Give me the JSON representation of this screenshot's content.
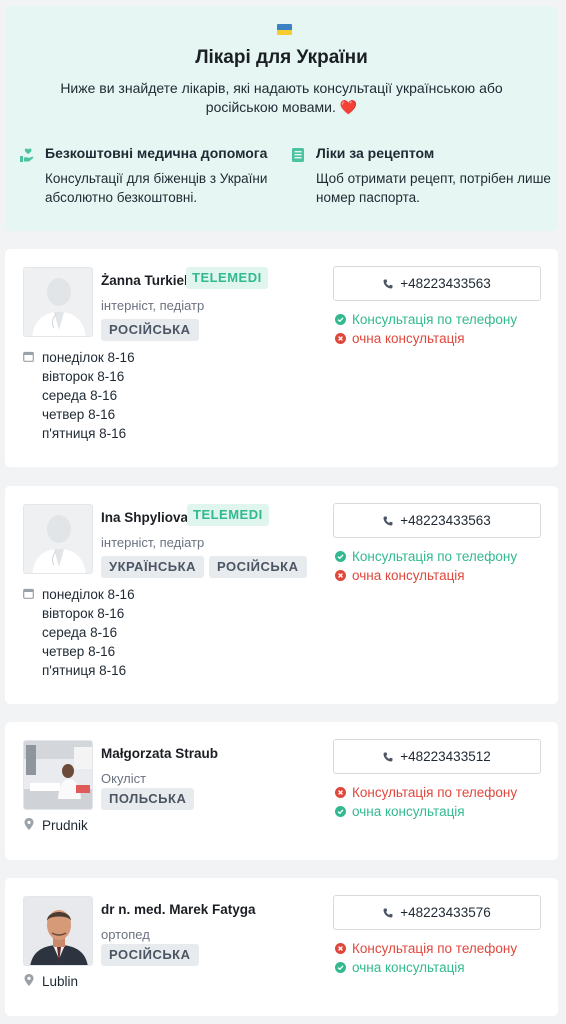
{
  "hero": {
    "title": "Лікарі для України",
    "subtitle": "Ниже ви знайдете лікарів, які надають консультації українською або російською мовами.",
    "heart": "❤️",
    "features": [
      {
        "icon": "hand-heart-icon",
        "title": "Безкоштовні медична допомога",
        "text": "Консультації для біженців з України абсолютно безкоштовні."
      },
      {
        "icon": "document-icon",
        "title": "Ліки за рецептом",
        "text": "Щоб отримати рецепт, потрібен лише номер паспорта."
      }
    ]
  },
  "colors": {
    "accent": "#31b98f",
    "danger": "#e0473c",
    "hero_bg": "#e6f6f2"
  },
  "doctors": [
    {
      "name": "Żanna Turkiel",
      "badge": "TELEMEDI",
      "specialty": "інтерніст, педіатр",
      "languages": [
        "РОСІЙСЬКА"
      ],
      "phone": "+48223433563",
      "schedule": [
        "понеділок 8-16",
        "вівторок 8-16",
        "середа 8-16",
        "четвер 8-16",
        "п'ятниця 8-16"
      ],
      "phone_consultation": {
        "label": "Консультація по телефону",
        "available": true
      },
      "in_person": {
        "label": "очна консультація",
        "available": false
      }
    },
    {
      "name": "Ina Shpyliova",
      "badge": "TELEMEDI",
      "specialty": "інтерніст, педіатр",
      "languages": [
        "УКРАЇНСЬКА",
        "РОСІЙСЬКА"
      ],
      "phone": "+48223433563",
      "schedule": [
        "понеділок 8-16",
        "вівторок 8-16",
        "середа 8-16",
        "четвер 8-16",
        "п'ятниця 8-16"
      ],
      "phone_consultation": {
        "label": "Консультація по телефону",
        "available": true
      },
      "in_person": {
        "label": "очна консультація",
        "available": false
      }
    },
    {
      "name": "Małgorzata Straub",
      "specialty": "Окуліст",
      "languages": [
        "ПОЛЬСЬКА"
      ],
      "phone": "+48223433512",
      "location": "Prudnik",
      "phone_consultation": {
        "label": "Консультація по телефону",
        "available": false
      },
      "in_person": {
        "label": "очна консультація",
        "available": true
      }
    },
    {
      "name": "dr n. med. Marek Fatyga",
      "specialty": "ортопед",
      "languages": [
        "РОСІЙСЬКА"
      ],
      "phone": "+48223433576",
      "location": "Lublin",
      "phone_consultation": {
        "label": "Консультація по телефону",
        "available": false
      },
      "in_person": {
        "label": "очна консультація",
        "available": true
      }
    }
  ]
}
